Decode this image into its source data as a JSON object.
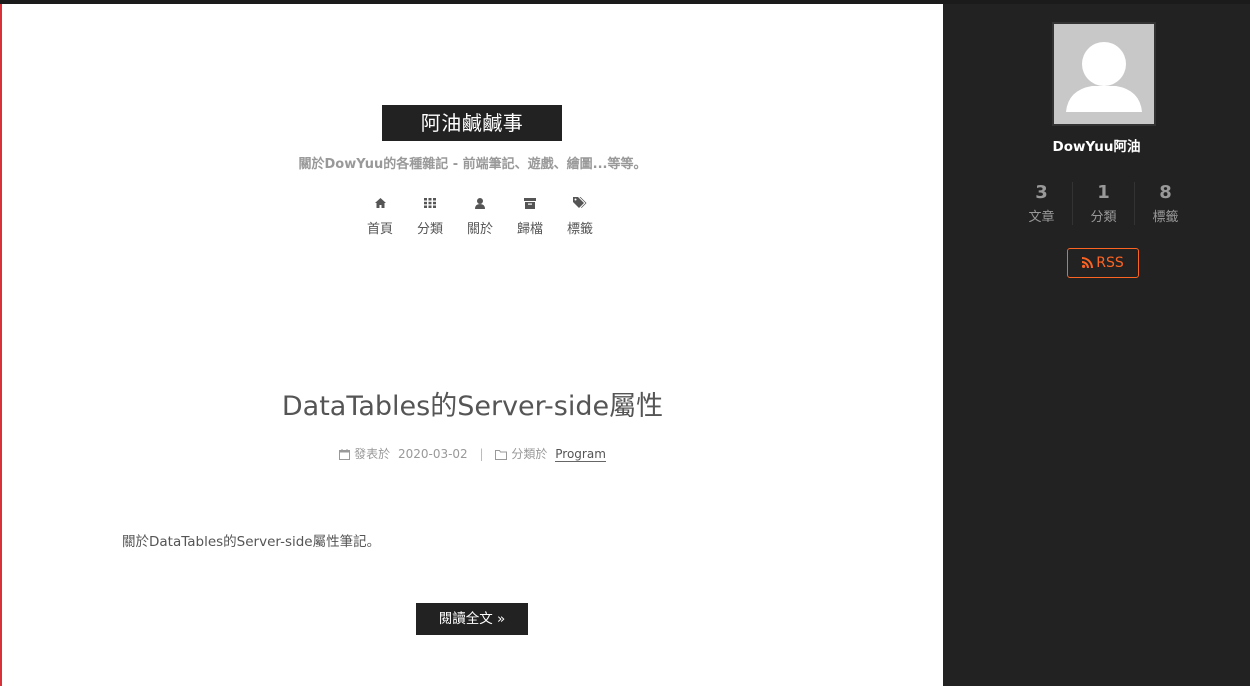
{
  "site": {
    "title": "阿油鹹鹹事",
    "subtitle": "關於DowYuu的各種雜記 - 前端筆記、遊戲、繪圖...等等。"
  },
  "nav": {
    "items": [
      {
        "label": "首頁",
        "icon": "home-icon"
      },
      {
        "label": "分類",
        "icon": "th-icon"
      },
      {
        "label": "關於",
        "icon": "user-icon"
      },
      {
        "label": "歸檔",
        "icon": "archive-icon"
      },
      {
        "label": "標籤",
        "icon": "tags-icon"
      }
    ]
  },
  "post": {
    "title": "DataTables的Server-side屬性",
    "meta": {
      "posted_label": "發表於",
      "date": "2020-03-02",
      "separator": "|",
      "category_label": "分類於",
      "category": "Program"
    },
    "excerpt": "關於DataTables的Server-side屬性筆記。",
    "read_more": "閱讀全文 »"
  },
  "sidebar": {
    "author": "DowYuu阿油",
    "stats": [
      {
        "count": "3",
        "label": "文章"
      },
      {
        "count": "1",
        "label": "分類"
      },
      {
        "count": "8",
        "label": "標籤"
      }
    ],
    "rss_label": "RSS"
  },
  "colors": {
    "dark": "#222222",
    "accent_rss": "#fc6423",
    "left_border": "#d9313a"
  }
}
